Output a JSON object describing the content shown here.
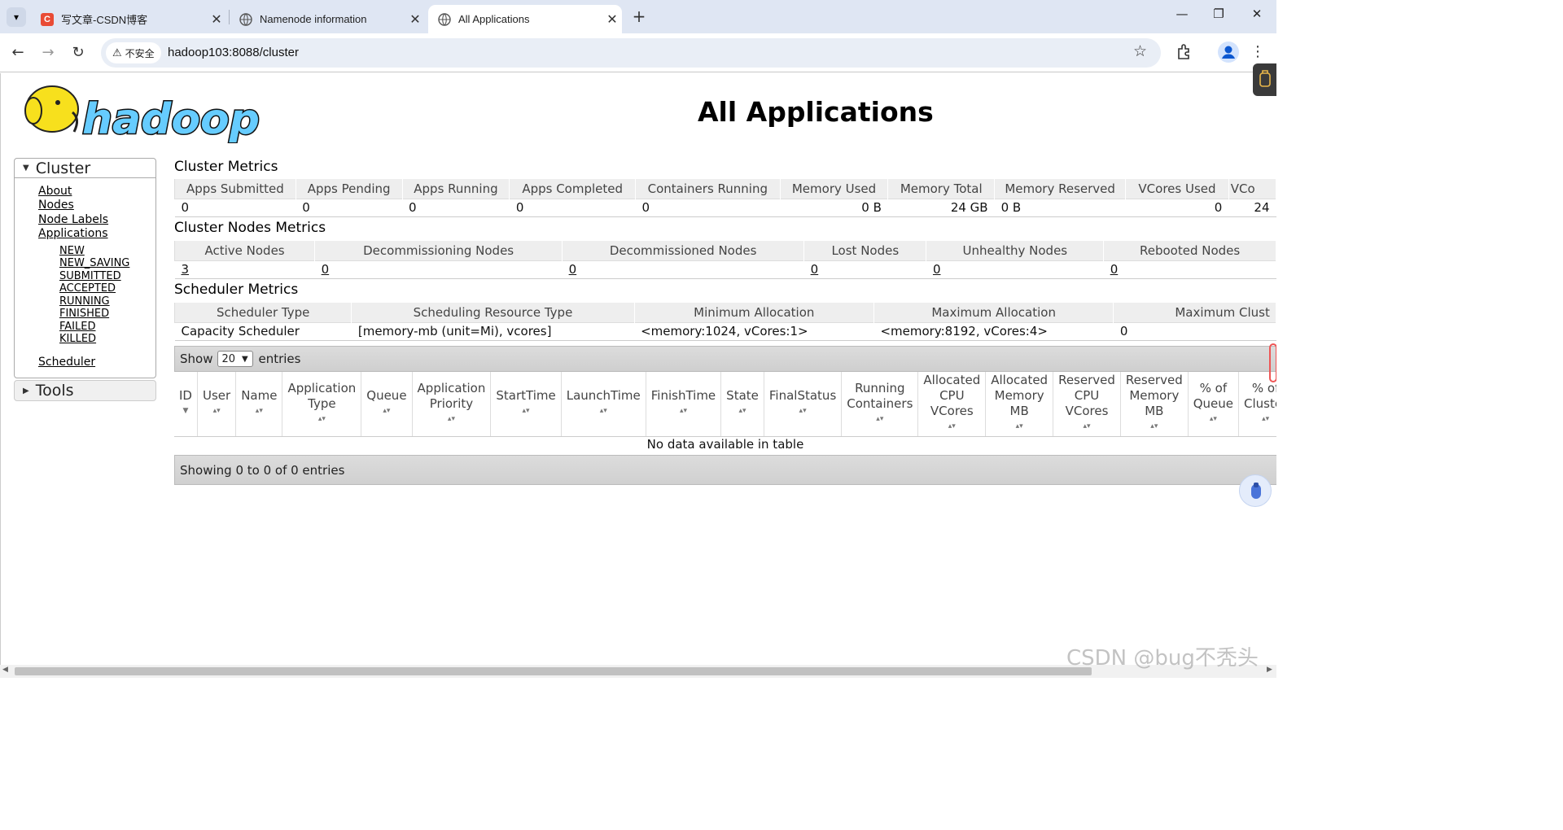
{
  "browser": {
    "tabs": [
      {
        "title": "写文章-CSDN博客",
        "favicon": "C"
      },
      {
        "title": "Namenode information",
        "favicon": "globe-icon"
      },
      {
        "title": "All Applications",
        "favicon": "globe-icon"
      }
    ],
    "security_label": "不安全",
    "url": "hadoop103:8088/cluster"
  },
  "page": {
    "title": "All Applications",
    "logo_text": "hadoop"
  },
  "sidebar": {
    "cluster_label": "Cluster",
    "links": [
      "About",
      "Nodes",
      "Node Labels",
      "Applications"
    ],
    "app_states": [
      "NEW",
      "NEW_SAVING",
      "SUBMITTED",
      "ACCEPTED",
      "RUNNING",
      "FINISHED",
      "FAILED",
      "KILLED"
    ],
    "scheduler_link": "Scheduler",
    "tools_label": "Tools"
  },
  "cluster_metrics": {
    "title": "Cluster Metrics",
    "headers": [
      "Apps Submitted",
      "Apps Pending",
      "Apps Running",
      "Apps Completed",
      "Containers Running",
      "Memory Used",
      "Memory Total",
      "Memory Reserved",
      "VCores Used",
      "VCo"
    ],
    "values": [
      "0",
      "0",
      "0",
      "0",
      "0",
      "0 B",
      "24 GB",
      "0 B",
      "0",
      "24"
    ]
  },
  "node_metrics": {
    "title": "Cluster Nodes Metrics",
    "headers": [
      "Active Nodes",
      "Decommissioning Nodes",
      "Decommissioned Nodes",
      "Lost Nodes",
      "Unhealthy Nodes",
      "Rebooted Nodes"
    ],
    "values": [
      "3",
      "0",
      "0",
      "0",
      "0",
      "0"
    ]
  },
  "scheduler_metrics": {
    "title": "Scheduler Metrics",
    "headers": [
      "Scheduler Type",
      "Scheduling Resource Type",
      "Minimum Allocation",
      "Maximum Allocation",
      "Maximum Clust"
    ],
    "values": [
      "Capacity Scheduler",
      "[memory-mb (unit=Mi), vcores]",
      "<memory:1024, vCores:1>",
      "<memory:8192, vCores:4>",
      "0"
    ]
  },
  "apps_table": {
    "show_label": "Show",
    "entries_value": "20",
    "entries_label": "entries",
    "columns": [
      "ID",
      "User",
      "Name",
      "Application Type",
      "Queue",
      "Application Priority",
      "StartTime",
      "LaunchTime",
      "FinishTime",
      "State",
      "FinalStatus",
      "Running Containers",
      "Allocated CPU VCores",
      "Allocated Memory MB",
      "Reserved CPU VCores",
      "Reserved Memory MB",
      "% of Queue",
      "% of Cluster"
    ],
    "empty_message": "No data available in table",
    "info": "Showing 0 to 0 of 0 entries"
  },
  "watermark": "CSDN @bug不秃头"
}
